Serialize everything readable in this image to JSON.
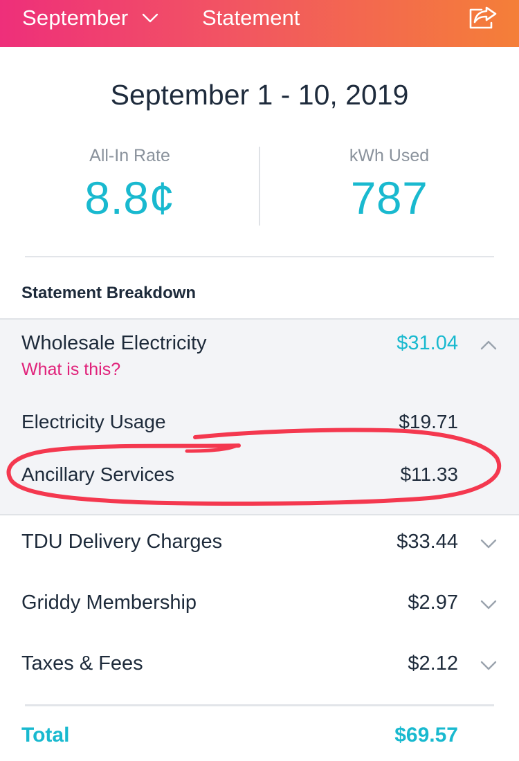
{
  "header": {
    "month": "September",
    "title": "Statement",
    "icons": {
      "month_dropdown": "chevron-down-icon",
      "share": "share-icon"
    }
  },
  "period": {
    "date_range": "September 1 - 10, 2019"
  },
  "stats": {
    "all_in_rate": {
      "label": "All-In Rate",
      "value": "8.8¢"
    },
    "kwh_used": {
      "label": "kWh Used",
      "value": "787"
    }
  },
  "breakdown": {
    "title": "Statement Breakdown",
    "wholesale": {
      "label": "Wholesale Electricity",
      "amount": "$31.04",
      "help_link": "What is this?",
      "expanded": true,
      "items": [
        {
          "label": "Electricity Usage",
          "amount": "$19.71"
        },
        {
          "label": "Ancillary Services",
          "amount": "$11.33"
        }
      ]
    },
    "rows": [
      {
        "label": "TDU Delivery Charges",
        "amount": "$33.44"
      },
      {
        "label": "Griddy Membership",
        "amount": "$2.97"
      },
      {
        "label": "Taxes & Fees",
        "amount": "$2.12"
      }
    ]
  },
  "total": {
    "label": "Total",
    "amount": "$69.57"
  },
  "colors": {
    "header_gradient_start": "#ee2f7a",
    "header_gradient_end": "#f47f38",
    "accent": "#19b9cf",
    "link": "#e0217a",
    "annotation": "#f4384f"
  }
}
